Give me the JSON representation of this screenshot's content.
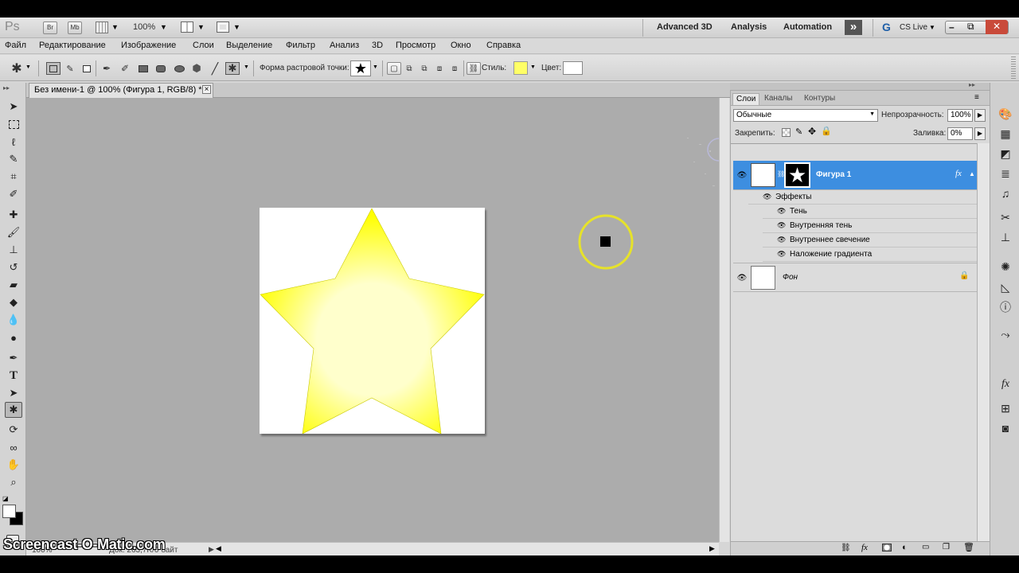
{
  "app": {
    "logo": "Ps"
  },
  "topbar": {
    "bridge_label": "Br",
    "minibridge_label": "Mb",
    "zoom": "100%",
    "workspaces": [
      "Advanced 3D",
      "Analysis",
      "Automation"
    ],
    "more_label": "»",
    "cs_live": "CS Live"
  },
  "menu": [
    "Файл",
    "Редактирование",
    "Изображение",
    "Слои",
    "Выделение",
    "Фильтр",
    "Анализ",
    "3D",
    "Просмотр",
    "Окно",
    "Справка"
  ],
  "options": {
    "shape_label": "Форма растровой точки:",
    "style_label": "Стиль:",
    "color_label": "Цвет:",
    "style_color": "#ffff66",
    "color_value": "#ffffff"
  },
  "document": {
    "tab_title": "Без имени-1 @ 100% (Фигура 1, RGB/8) *",
    "close_label": "×",
    "star_color": "#ffff00",
    "star_glow": "#ffffcc"
  },
  "status": {
    "zoom": "100%",
    "doc_info": "Док: 263,7K/0 байт"
  },
  "layers": {
    "tabs": [
      "Слои",
      "Каналы",
      "Контуры"
    ],
    "blend_mode": "Обычные",
    "opacity_label": "Непрозрачность:",
    "opacity_value": "100%",
    "lock_label": "Закрепить:",
    "fill_label": "Заливка:",
    "fill_value": "0%",
    "items": [
      {
        "name": "Фигура 1",
        "selected": true,
        "fx": "fx"
      },
      {
        "name": "Фон",
        "selected": false
      }
    ],
    "effects_header": "Эффекты",
    "effects": [
      "Тень",
      "Внутренняя тень",
      "Внутреннее свечение",
      "Наложение градиента"
    ]
  },
  "watermark": "Screencast-O-Matic.com",
  "colors": {
    "selection": "#3d8ee0",
    "cursor_ring": "#e6e22a",
    "canvas_bg": "#acacac"
  }
}
